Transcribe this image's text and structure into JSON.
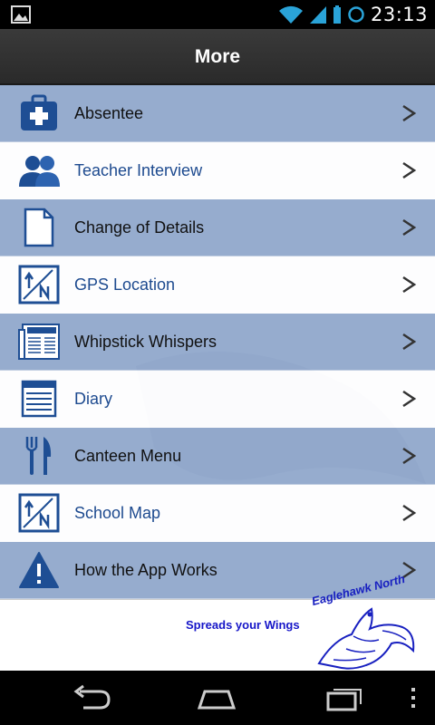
{
  "status_bar": {
    "time": "23:13"
  },
  "header": {
    "title": "More"
  },
  "menu": {
    "items": [
      {
        "label": "Absentee",
        "icon": "medical-kit-icon"
      },
      {
        "label": "Teacher Interview",
        "icon": "people-icon"
      },
      {
        "label": "Change of Details",
        "icon": "document-icon"
      },
      {
        "label": "GPS Location",
        "icon": "map-location-icon"
      },
      {
        "label": "Whipstick Whispers",
        "icon": "newspaper-icon"
      },
      {
        "label": "Diary",
        "icon": "notepad-icon"
      },
      {
        "label": "Canteen Menu",
        "icon": "fork-knife-icon"
      },
      {
        "label": "School Map",
        "icon": "map-location-icon"
      },
      {
        "label": "How the App Works",
        "icon": "warning-icon"
      }
    ]
  },
  "footer": {
    "tagline": "Spreads your Wings",
    "brand": "Eaglehawk North"
  },
  "colors": {
    "row_dark": "#7493c4",
    "label_light": "#1d4a8f",
    "icon_blue": "#1e4e94"
  }
}
